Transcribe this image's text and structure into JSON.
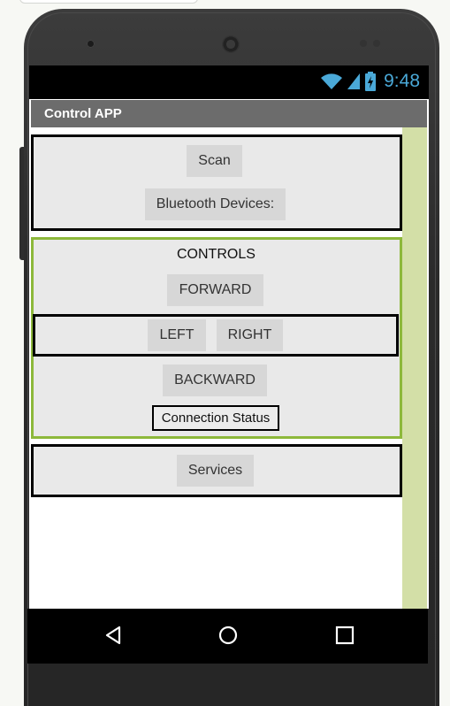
{
  "status_bar": {
    "time": "9:48",
    "wifi_icon": "wifi-icon",
    "signal_icon": "cell-signal-icon",
    "battery_icon": "battery-charging-icon",
    "icon_color": "#4aa9d8"
  },
  "app": {
    "title": "Control APP"
  },
  "scan_section": {
    "scan_label": "Scan",
    "devices_label": "Bluetooth Devices:"
  },
  "controls_section": {
    "heading": "CONTROLS",
    "forward_label": "FORWARD",
    "left_label": "LEFT",
    "right_label": "RIGHT",
    "backward_label": "BACKWARD",
    "connection_status": "Connection Status"
  },
  "services_section": {
    "services_label": "Services"
  },
  "navigation": {
    "back_icon": "back-triangle-icon",
    "home_icon": "home-circle-icon",
    "recents_icon": "recents-square-icon"
  },
  "colors": {
    "title_bar": "#6c6c6c",
    "arrangement_bg": "#e9e9e9",
    "button_bg": "#d7d7d7",
    "controls_border": "#8db83b",
    "side_strip": "#d3dfa7"
  }
}
